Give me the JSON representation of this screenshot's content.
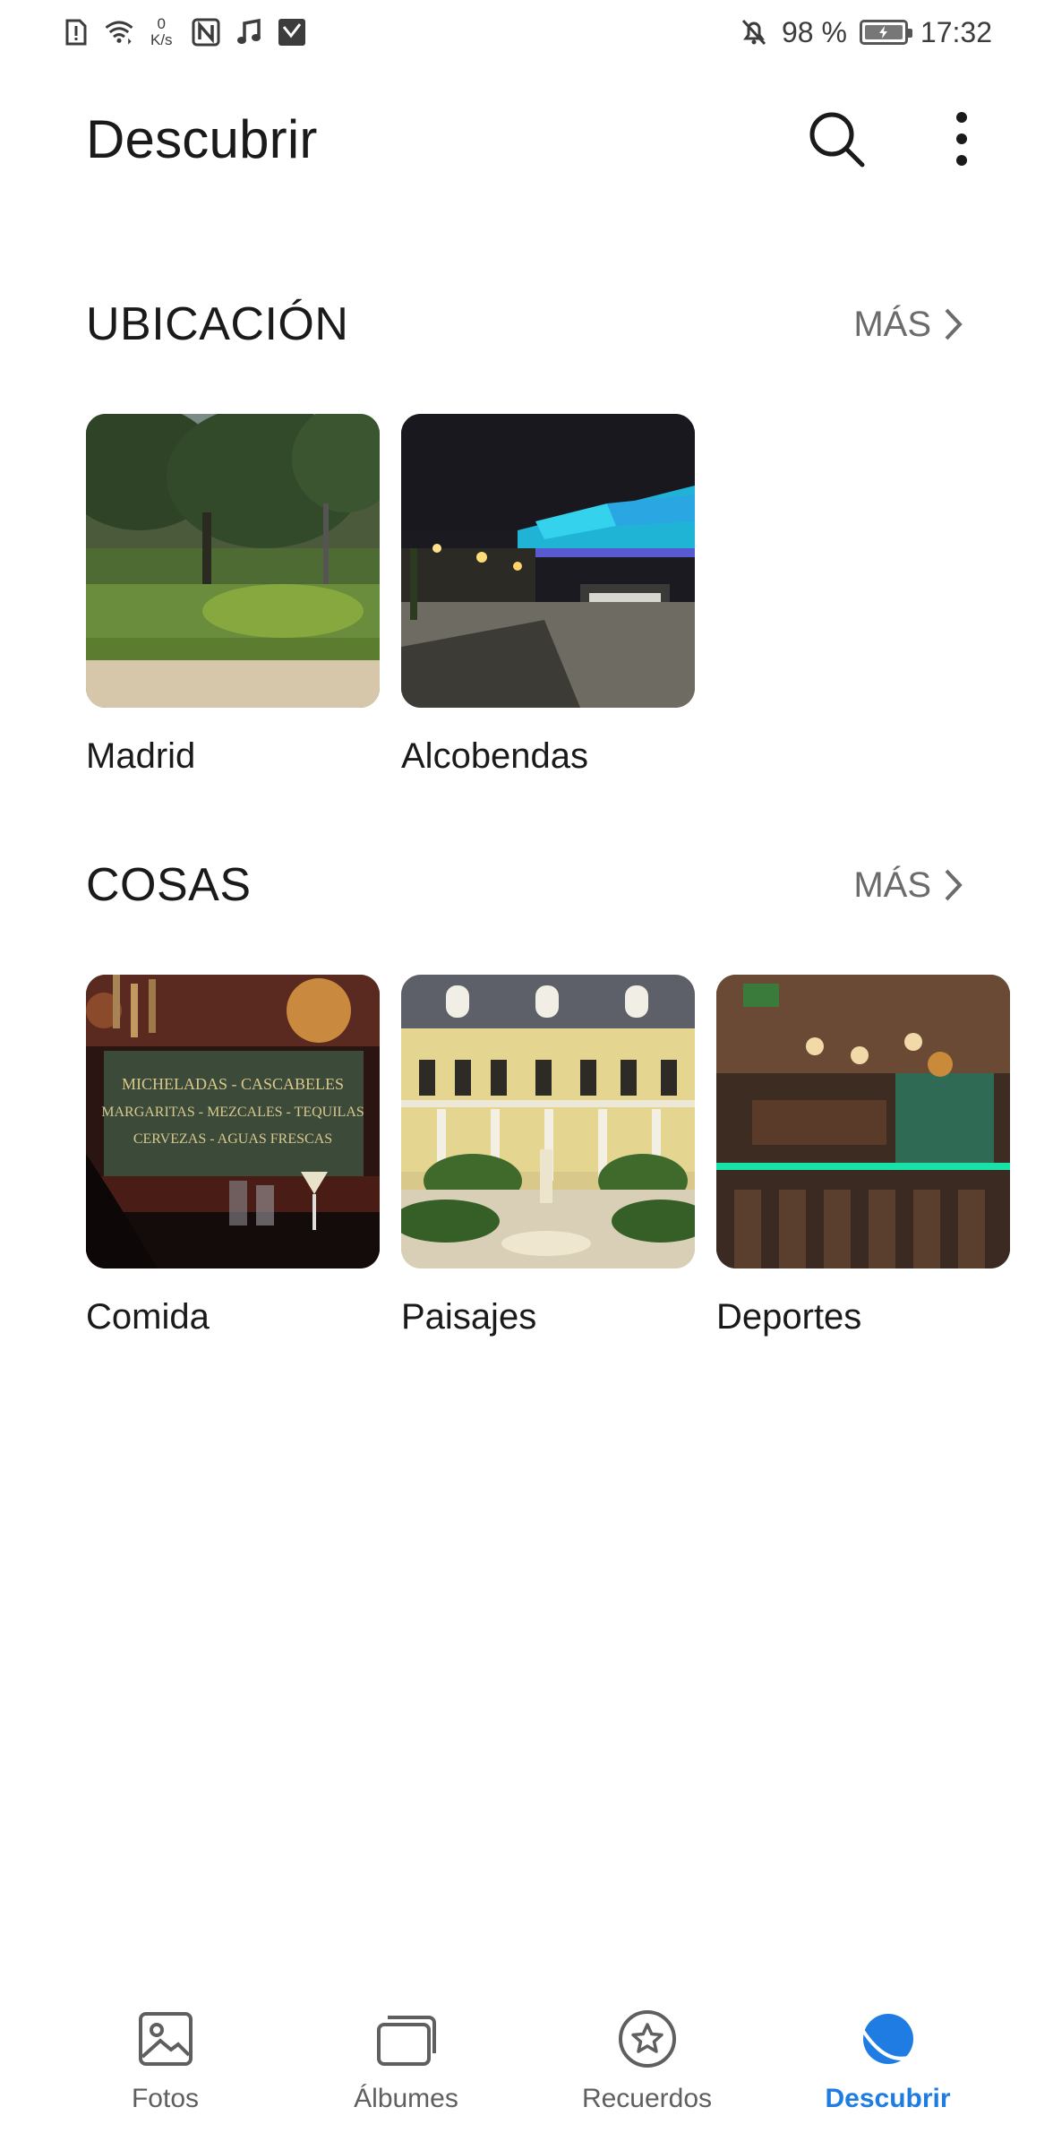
{
  "status_bar": {
    "net_speed_value": "0",
    "net_speed_unit": "K/s",
    "battery_percent": "98 %",
    "time": "17:32",
    "icons": [
      "sim-alert-icon",
      "wifi-icon",
      "nfc-icon",
      "music-note-icon",
      "app-notification-icon",
      "bell-off-icon",
      "battery-icon"
    ]
  },
  "app_bar": {
    "title": "Descubrir",
    "icons": [
      "search-icon",
      "more-vert-icon"
    ]
  },
  "sections": {
    "location": {
      "title": "UBICACIÓN",
      "more_label": "MÁS",
      "items": [
        {
          "label": "Madrid"
        },
        {
          "label": "Alcobendas"
        }
      ]
    },
    "things": {
      "title": "COSAS",
      "more_label": "MÁS",
      "items": [
        {
          "label": "Comida"
        },
        {
          "label": "Paisajes"
        },
        {
          "label": "Deportes"
        }
      ]
    }
  },
  "thumbnail_signs": {
    "comida_line1": "MICHELADAS - CASCABELES",
    "comida_line2": "MARGARITAS - MEZCALES - TEQUILAS",
    "comida_line3": "CERVEZAS - AGUAS FRESCAS"
  },
  "bottom_nav": {
    "items": [
      {
        "label": "Fotos",
        "icon": "image-icon"
      },
      {
        "label": "Álbumes",
        "icon": "albums-icon"
      },
      {
        "label": "Recuerdos",
        "icon": "star-circle-icon"
      },
      {
        "label": "Descubrir",
        "icon": "planet-icon",
        "active": true
      }
    ]
  },
  "colors": {
    "accent": "#1e7ce3",
    "text_primary": "#1a1a1a",
    "text_secondary": "#6b6b6b",
    "background": "#ffffff"
  }
}
